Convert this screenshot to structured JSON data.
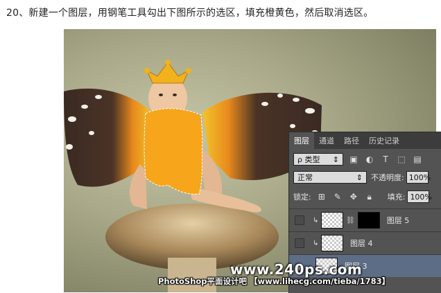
{
  "instruction": "20、新建一个图层，用钢笔工具勾出下图所示的选区，填充橙黄色，然后取消选区。",
  "colors": {
    "fill": "#f7a51b",
    "crown": "#f1b21c",
    "wing_orange": "#e8891d",
    "wing_dark": "#3a2a22",
    "panel_bg": "#535353",
    "selected_layer": "#5d6d85"
  },
  "ps_panel": {
    "tabs": [
      "图层",
      "通道",
      "路径",
      "历史记录"
    ],
    "filter_label": "ρ 类型",
    "blend_mode": "正常",
    "opacity_label": "不透明度:",
    "opacity_value": "100%",
    "lock_label": "锁定:",
    "fill_label": "填充:",
    "fill_value": "100%",
    "filter_icons": [
      "image-filter-icon",
      "adjustment-filter-icon",
      "type-filter-icon",
      "shape-filter-icon",
      "smart-object-filter-icon"
    ],
    "lock_icons": [
      "lock-pixels-icon",
      "lock-brush-icon",
      "lock-move-icon",
      "lock-all-icon"
    ],
    "layers": [
      {
        "name": "图层 5"
      },
      {
        "name": "图层 4"
      },
      {
        "name": "图层 3"
      }
    ]
  },
  "watermark": {
    "site": "www.240ps.com",
    "caption": "PhotoShop平面设计吧 【www.lihecg.com/tieba/1783】"
  }
}
